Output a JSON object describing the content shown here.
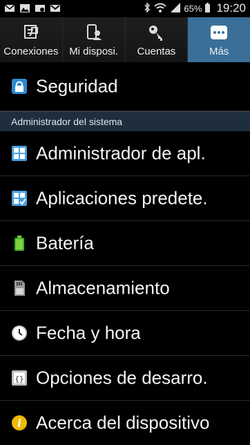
{
  "status_bar": {
    "battery_percent": "65%",
    "time": "19:20"
  },
  "tabs": [
    {
      "label": "Conexiones",
      "icon": "connections-icon"
    },
    {
      "label": "Mi disposi.",
      "icon": "my-device-icon"
    },
    {
      "label": "Cuentas",
      "icon": "accounts-key-icon"
    },
    {
      "label": "Más",
      "icon": "more-dots-icon",
      "active": true
    }
  ],
  "items_top": [
    {
      "label": "Seguridad",
      "icon": "lock-icon"
    }
  ],
  "section": {
    "label": "Administrador del sistema"
  },
  "items": [
    {
      "label": "Administrador de apl.",
      "icon": "app-manager-icon"
    },
    {
      "label": "Aplicaciones predete.",
      "icon": "default-apps-icon"
    },
    {
      "label": "Batería",
      "icon": "battery-icon"
    },
    {
      "label": "Almacenamiento",
      "icon": "storage-icon"
    },
    {
      "label": "Fecha y hora",
      "icon": "clock-icon"
    },
    {
      "label": "Opciones de desarro.",
      "icon": "developer-options-icon"
    },
    {
      "label": "Acerca del dispositivo",
      "icon": "info-icon"
    }
  ],
  "colors": {
    "active_tab": "#3b6f98",
    "section_bg": "#1f2e3c"
  }
}
